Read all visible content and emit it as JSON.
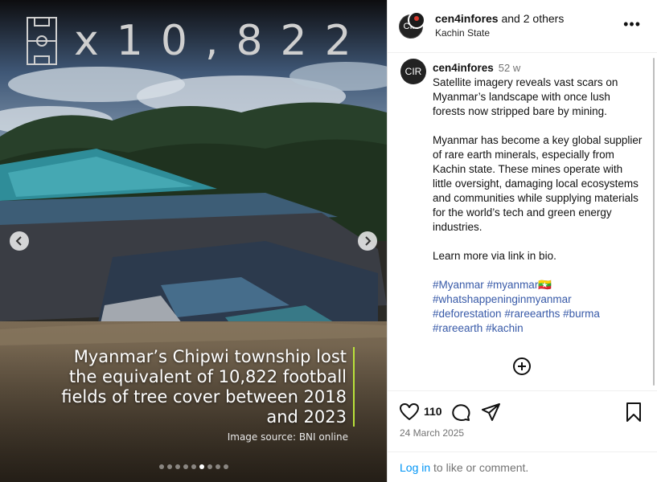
{
  "media": {
    "counter": "x10,822",
    "caption": "Myanmar’s Chipwi township lost the equivalent of 10,822 football fields of tree cover between 2018 and 2023",
    "source": "Image source: BNI online",
    "slide_count": 9,
    "active_slide_index": 5,
    "accent_color": "#b9e23a"
  },
  "header": {
    "avatar_text": "CIR",
    "username": "cen4infores",
    "others": "and 2 others",
    "location": "Kachin State",
    "more_label": "•••"
  },
  "caption": {
    "avatar_text": "CIR",
    "username": "cen4infores",
    "time": "52 w",
    "paragraphs": [
      "Satellite imagery reveals vast scars on Myanmar’s landscape with once lush forests now stripped bare by mining.",
      "Myanmar has become a key global supplier of rare earth minerals, especially from Kachin state. These mines operate with little oversight, damaging local ecosystems and communities while supplying materials for the world’s tech and green energy industries.",
      "Learn more via link in bio."
    ],
    "hashtags": {
      "line1a": "#Myanmar",
      "line1b": "#myanmar",
      "line1_emoji": "🇲🇲",
      "line2": "#whatshappeninginmyanmar",
      "line3a": "#deforestation",
      "line3b": "#rareearths",
      "line3c": "#burma",
      "line4a": "#rareearth",
      "line4b": "#kachin"
    }
  },
  "actions": {
    "likes": "110",
    "date": "24 March 2025",
    "login_link": "Log in",
    "login_suffix": " to like or comment."
  }
}
